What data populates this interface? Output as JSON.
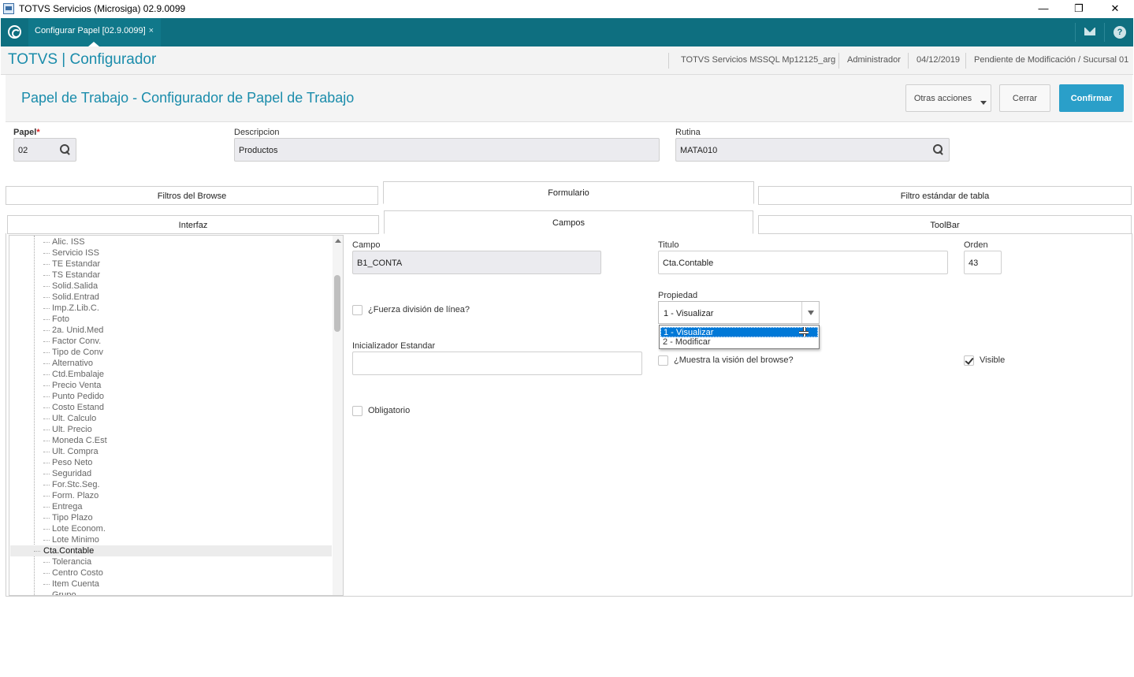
{
  "window": {
    "title": "TOTVS Servicios (Microsiga) 02.9.0099",
    "minimize": "—",
    "restore": "❐",
    "close": "✕"
  },
  "tabbar": {
    "tab_label": "Configurar Papel [02.9.0099]",
    "tab_close": "×"
  },
  "header": {
    "brand": "TOTVS | Configurador",
    "server": "TOTVS Servicios MSSQL Mp12125_arg",
    "user": "Administrador",
    "date": "04/12/2019",
    "status": "Pendiente de Modificación / Sucursal 01"
  },
  "page": {
    "title": "Papel de Trabajo - Configurador de Papel de Trabajo",
    "actions": {
      "other": "Otras acciones",
      "close": "Cerrar",
      "confirm": "Confirmar"
    }
  },
  "form": {
    "papel": {
      "label": "Papel",
      "required_mark": "*",
      "value": "02"
    },
    "descripcion": {
      "label": "Descripcion",
      "value": "Productos"
    },
    "rutina": {
      "label": "Rutina",
      "value": "MATA010"
    }
  },
  "tabs_top": [
    "Filtros del Browse",
    "Formulario",
    "Filtro estándar de tabla"
  ],
  "tabs_bottom": [
    "Interfaz",
    "Campos",
    "ToolBar"
  ],
  "tree": {
    "items": [
      "Alic. ISS",
      "Servicio ISS",
      "TE Estandar",
      "TS Estandar",
      "Solid.Salida",
      "Solid.Entrad",
      "Imp.Z.Lib.C.",
      "Foto",
      "2a. Unid.Med",
      "Factor Conv.",
      "Tipo de Conv",
      "Alternativo",
      "Ctd.Embalaje",
      "Precio Venta",
      "Punto Pedido",
      "Costo Estand",
      "Ult. Calculo",
      "Ult. Precio",
      "Moneda C.Est",
      "Ult. Compra",
      "Peso Neto",
      "Seguridad",
      "For.Stc.Seg.",
      "Form. Plazo",
      "Entrega",
      "Tipo Plazo",
      "Lote Econom.",
      "Lote Minimo",
      "Cta.Contable",
      "Tolerancia",
      "Centro Costo",
      "Item Cuenta",
      "Grupo"
    ],
    "selected": "Cta.Contable"
  },
  "campo": {
    "campo_label": "Campo",
    "campo_value": "B1_CONTA",
    "titulo_label": "Titulo",
    "titulo_value": "Cta.Contable",
    "orden_label": "Orden",
    "orden_value": "43",
    "fuerza_label": "¿Fuerza división de línea?",
    "propiedad_label": "Propiedad",
    "propiedad_value": "1 - Visualizar",
    "propiedad_options": [
      "1 - Visualizar",
      "2 - Modificar"
    ],
    "inicializador_label": "Inicializador Estandar",
    "inicializador_value": "",
    "muestra_label": "¿Muestra la visión del browse?",
    "visible_label": "Visible",
    "visible_checked": true,
    "obligatorio_label": "Obligatorio"
  }
}
